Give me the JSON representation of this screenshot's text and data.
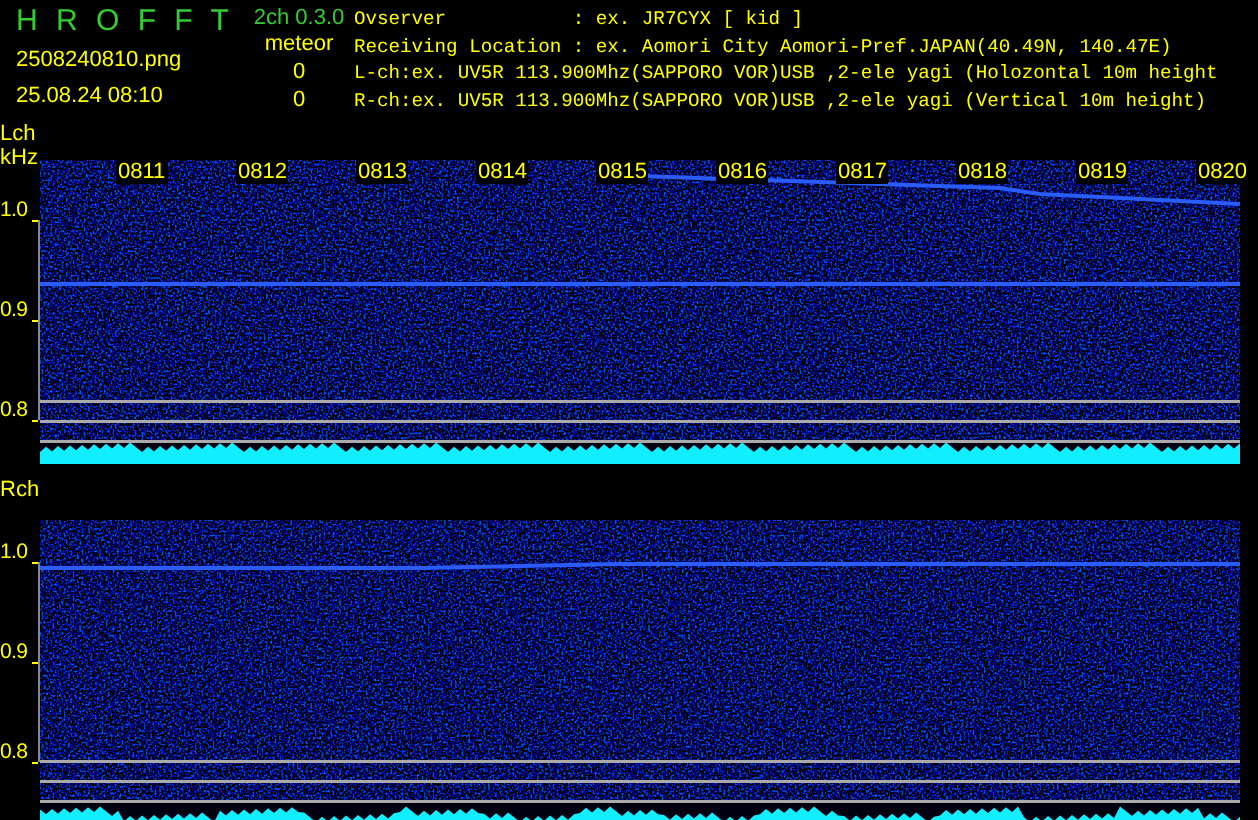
{
  "header": {
    "app_title": "H R O F F T",
    "filename": "2508240810.png",
    "datetime": "25.08.24 08:10",
    "version": "2ch 0.3.0",
    "count_label": "meteor",
    "counts": [
      "0",
      "0"
    ],
    "info_lines": [
      "Ovserver           : ex. JR7CYX [ kid ]",
      "Receiving Location : ex. Aomori City Aomori-Pref.JAPAN(40.49N, 140.47E)",
      "L-ch:ex. UV5R 113.900Mhz(SAPPORO VOR)USB ,2-ele yagi (Holozontal 10m height",
      "R-ch:ex. UV5R 113.900Mhz(SAPPORO VOR)USB ,2-ele yagi (Vertical 10m height)"
    ]
  },
  "channels": [
    {
      "name": "Lch",
      "unit": "kHz",
      "time_labels": [
        "0811",
        "0812",
        "0813",
        "0814",
        "0815",
        "0816",
        "0817",
        "0818",
        "0819",
        "0820"
      ],
      "y_labels": [
        "1.0",
        "0.9",
        "0.8"
      ]
    },
    {
      "name": "Rch",
      "y_labels": [
        "1.0",
        "0.9",
        "0.8"
      ]
    }
  ]
}
